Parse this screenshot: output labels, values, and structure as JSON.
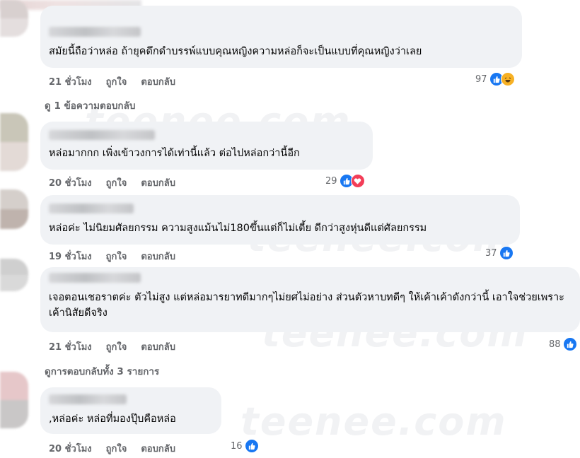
{
  "comments": [
    {
      "text": "สมัยนี้ถือว่าหล่อ ถ้ายุคดึกดำบรรพ์แบบคุณหญิงความหล่อก็จะเป็นแบบที่คุณหญิงว่าเลย",
      "time": "21 ชั่วโมง",
      "like_label": "ถูกใจ",
      "reply_label": "ตอบกลับ",
      "reaction_count": "97",
      "reactions": [
        "like-icon",
        "haha-icon"
      ],
      "view_replies": "ดู 1 ข้อความตอบกลับ",
      "avatar_colors": [
        "#d8d0cf",
        "#e4dede"
      ]
    },
    {
      "text": "หล่อมากกก เพิ่งเข้าวงการได้เท่านี้แล้ว ต่อไปหล่อกว่านี้อีก",
      "time": "20 ชั่วโมง",
      "like_label": "ถูกใจ",
      "reply_label": "ตอบกลับ",
      "reaction_count": "29",
      "reactions": [
        "like-icon",
        "love-icon"
      ],
      "avatar_colors": [
        "#c9c6b8",
        "#e3dad6"
      ]
    },
    {
      "text": "หล่อค่ะ ไม่นิยมศัลยกรรม ความสูงแม้นไม่180ขึ้นแต่ก็ไม่เตี้ย ดีกว่าสูงหุ่นดีแต่ศัลยกรรม",
      "time": "19 ชั่วโมง",
      "like_label": "ถูกใจ",
      "reply_label": "ตอบกลับ",
      "reaction_count": "37",
      "reactions": [
        "like-icon"
      ],
      "avatar_colors": [
        "#d5cfcb",
        "#bfb3ad"
      ]
    },
    {
      "text": "เจอตอนเชอราตค่ะ ตัวไม่สูง แต่หล่อมารยาทดีมากๆไม่ยศไม่อย่าง ส่วนตัวหาบทดีๆ ให้เค้าเค้าดังกว่านี้ เอาใจช่วยเพราะเค้านิสัยดีจริง",
      "time": "21 ชั่วโมง",
      "like_label": "ถูกใจ",
      "reply_label": "ตอบกลับ",
      "reaction_count": "88",
      "reactions": [
        "like-icon"
      ],
      "view_replies": "ดูการตอบกลับทั้ง 3 รายการ",
      "avatar_colors": [
        "#cfcfcf",
        "#d9d9d9"
      ]
    },
    {
      "text": ",หล่อค่ะ หล่อที่มองปุ๊บคือหล่อ",
      "time": "20 ชั่วโมง",
      "like_label": "ถูกใจ",
      "reply_label": "ตอบกลับ",
      "reaction_count": "16",
      "reactions": [
        "like-icon"
      ],
      "avatar_colors": [
        "#e6c7c9",
        "#c9c7c7"
      ]
    }
  ],
  "watermark": "teenee.com",
  "colors": {
    "bubble": "#f0f2f5",
    "action_text": "#65676b",
    "like": "#1877f2",
    "love": "#f33e58",
    "haha": "#f7b125"
  }
}
